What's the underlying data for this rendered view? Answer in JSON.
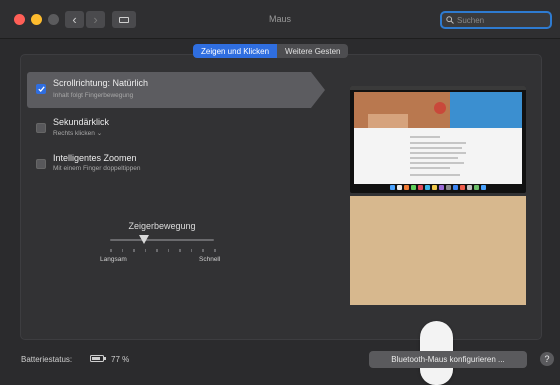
{
  "window": {
    "title": "Maus",
    "search_placeholder": "Suchen"
  },
  "tabs": [
    {
      "label": "Zeigen und Klicken",
      "active": true
    },
    {
      "label": "Weitere Gesten",
      "active": false
    }
  ],
  "options": [
    {
      "title": "Scrollrichtung: Natürlich",
      "subtitle": "Inhalt folgt Fingerbewegung",
      "checked": true,
      "selected": true
    },
    {
      "title": "Sekundärklick",
      "subtitle": "Rechts klicken ⌄",
      "checked": false,
      "selected": false
    },
    {
      "title": "Intelligentes Zoomen",
      "subtitle": "Mit einem Finger doppeltippen",
      "checked": false,
      "selected": false
    }
  ],
  "tracking": {
    "label": "Zeigerbewegung",
    "min_label": "Langsam",
    "max_label": "Schnell",
    "value": 0.33,
    "ticks": 10
  },
  "footer": {
    "battery_label": "Batteriestatus:",
    "battery_percent": "77 %",
    "battery_level": 0.77,
    "bluetooth_button": "Bluetooth-Maus konfigurieren ...",
    "help": "?"
  },
  "colors": {
    "accent": "#2f6ee0",
    "close": "#ff5f57",
    "minimize": "#febc2e"
  }
}
